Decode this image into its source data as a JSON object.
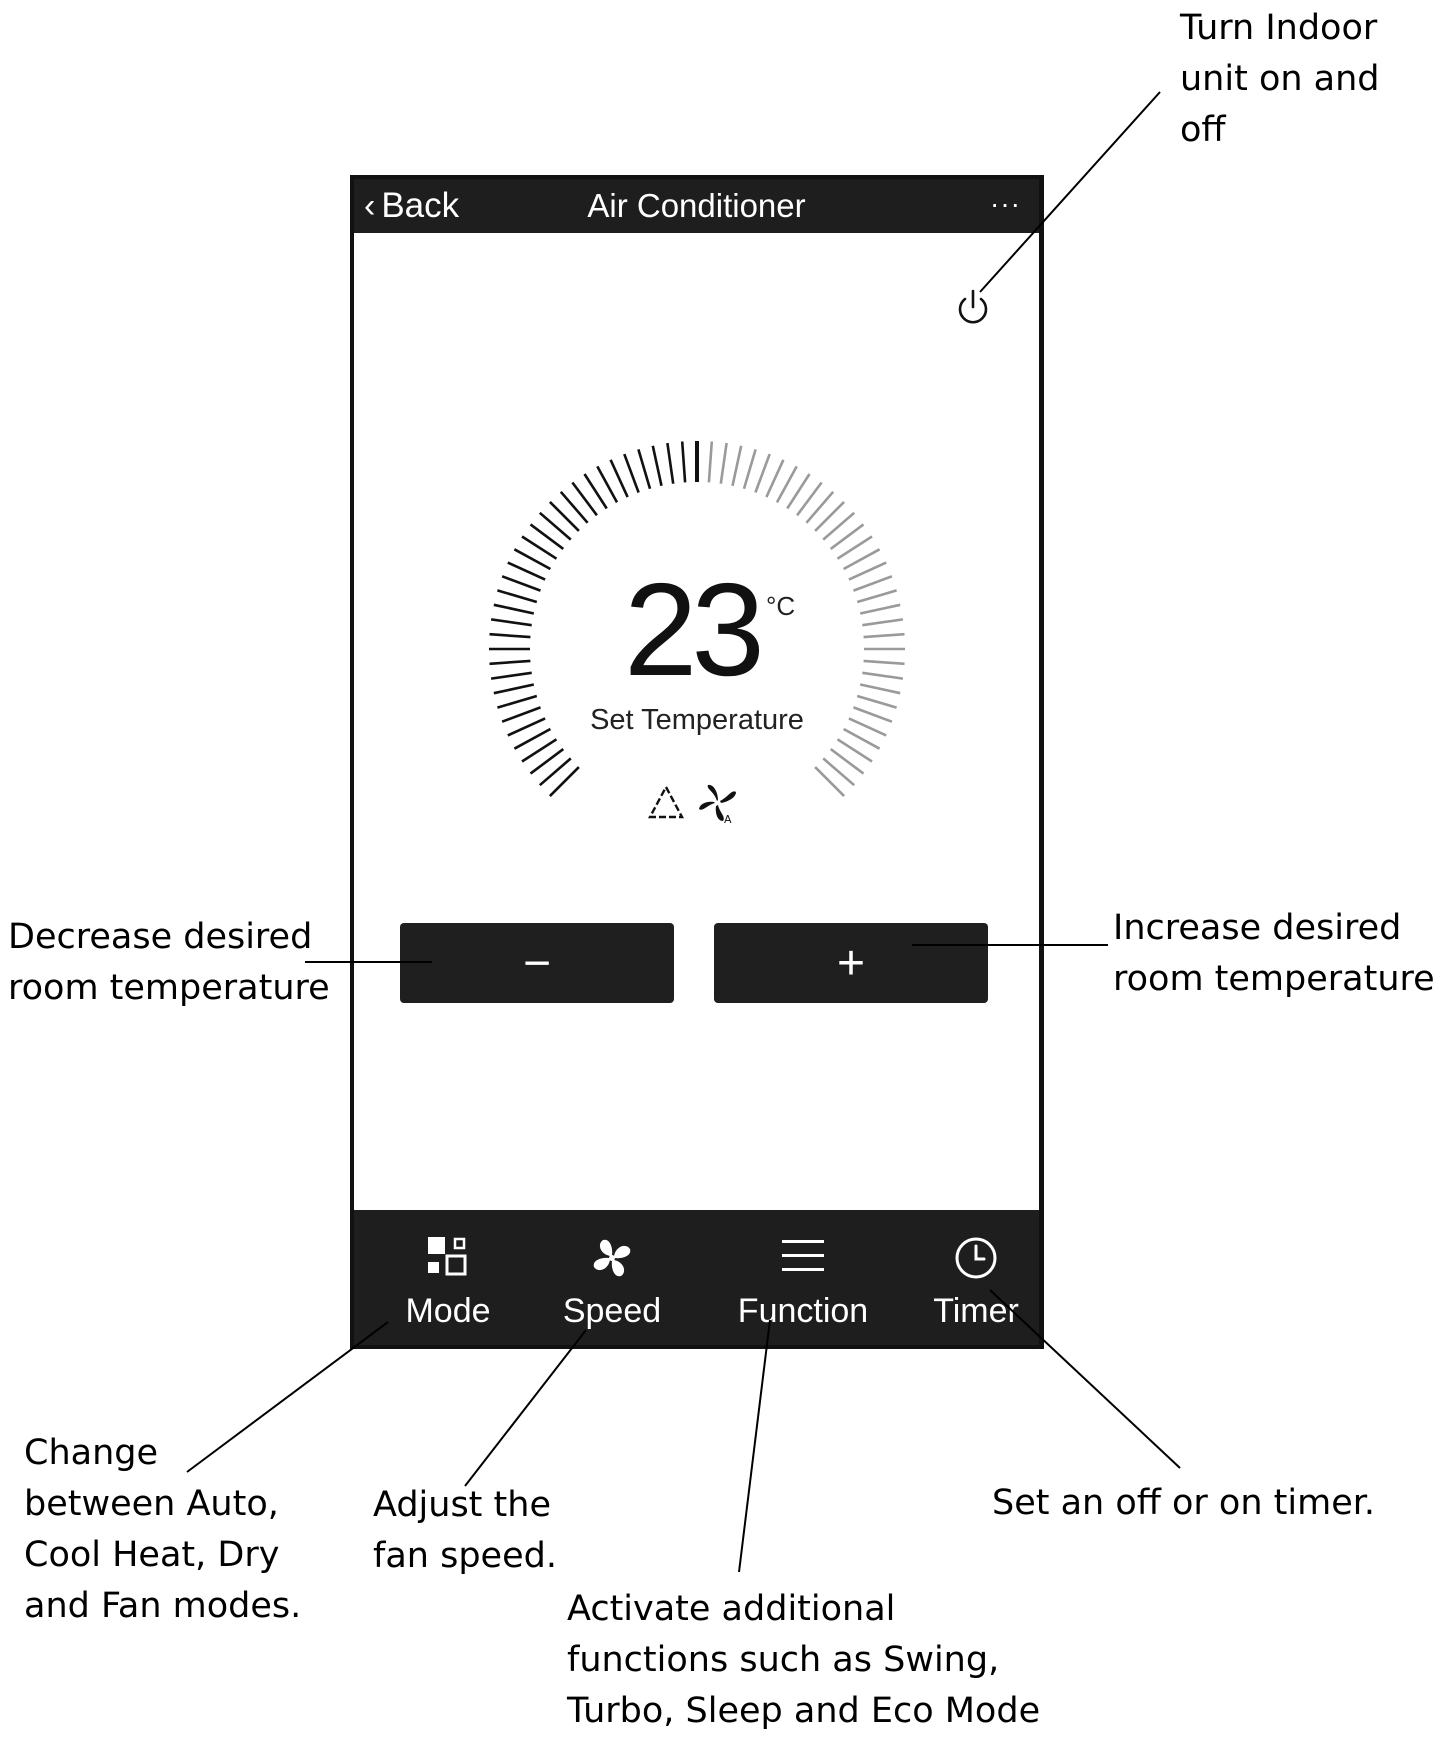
{
  "app": {
    "back_label": "Back",
    "title": "Air Conditioner",
    "more_label": "···"
  },
  "thermostat": {
    "value": "23",
    "unit": "°C",
    "label": "Set Temperature",
    "mode_icons": [
      "triangle-mode-icon",
      "fan-auto-icon"
    ]
  },
  "controls": {
    "minus_label": "−",
    "plus_label": "+"
  },
  "tabs": [
    {
      "label": "Mode",
      "icon": "mode-grid-icon"
    },
    {
      "label": "Speed",
      "icon": "fan-icon"
    },
    {
      "label": "Function",
      "icon": "menu-icon"
    },
    {
      "label": "Timer",
      "icon": "clock-icon"
    }
  ],
  "annotations": {
    "power": "Turn Indoor\nunit on and\noff",
    "decrease": "Decrease desired\nroom temperature",
    "increase": "Increase desired\nroom temperature",
    "mode": "Change\nbetween Auto,\nCool Heat, Dry\nand Fan modes.",
    "speed": "Adjust the\nfan speed.",
    "function": "Activate additional\nfunctions such as Swing,\nTurbo, Sleep and Eco Mode",
    "timer": "Set an off or on timer."
  }
}
